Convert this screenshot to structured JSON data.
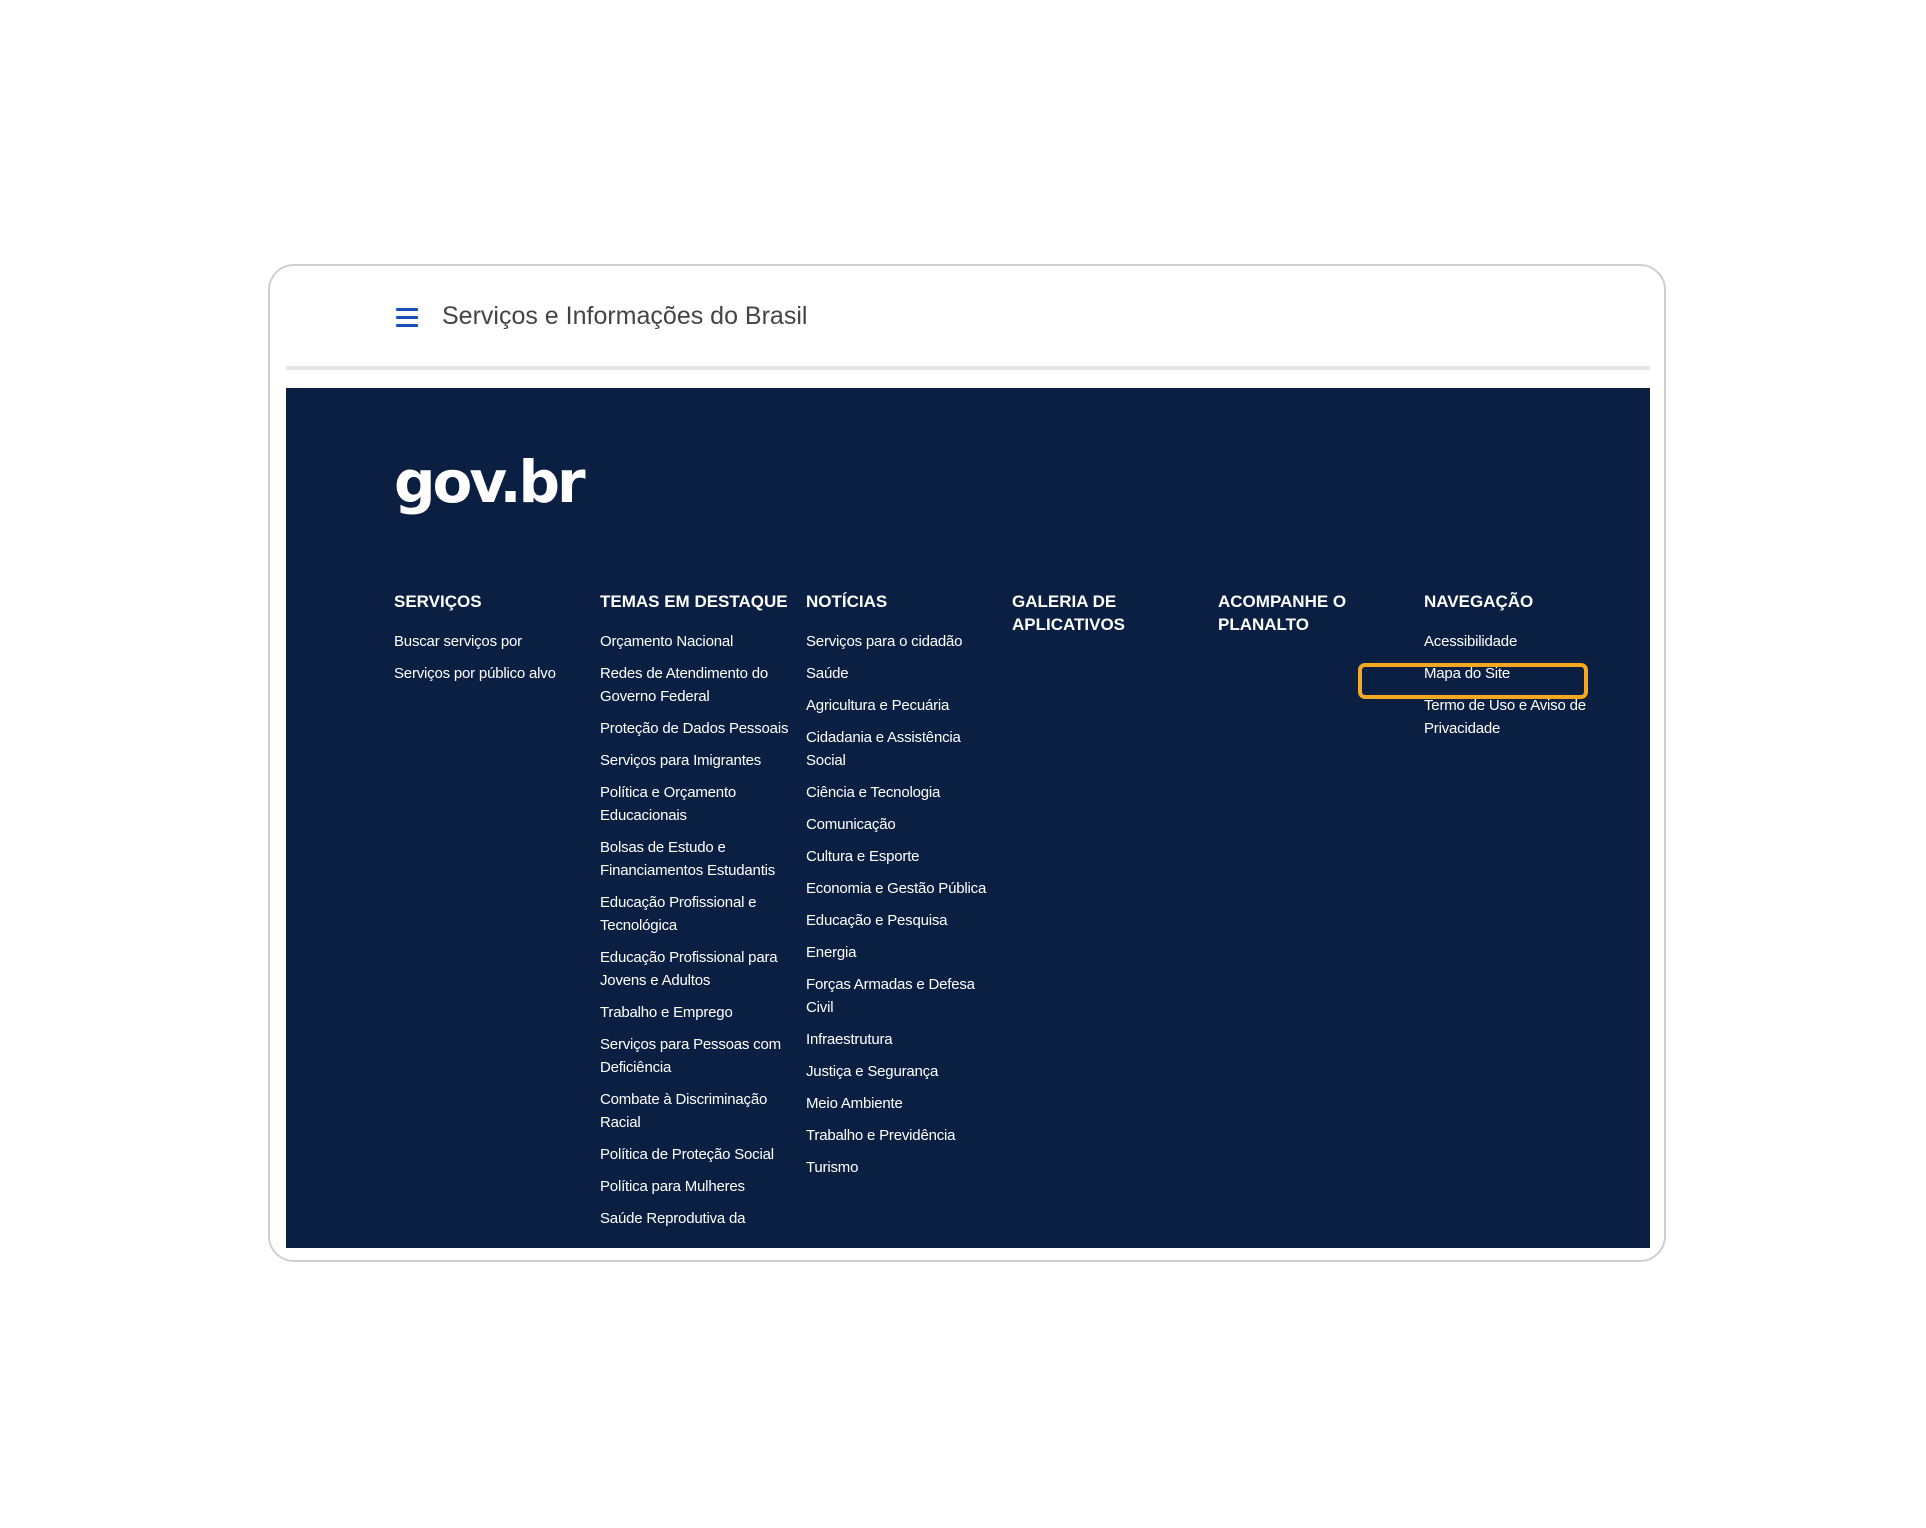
{
  "header": {
    "menu_icon": "hamburger-menu-icon",
    "title": "Serviços e Informações do Brasil",
    "accent_color": "#1351b4"
  },
  "footer": {
    "background_color": "#0b1f42",
    "logo_text": "gov.br",
    "columns": [
      {
        "heading": "SERVIÇOS",
        "links": [
          "Buscar serviços por",
          "Serviços por público alvo"
        ]
      },
      {
        "heading": "TEMAS EM DESTAQUE",
        "links": [
          "Orçamento Nacional",
          "Redes de Atendimento do Governo Federal",
          "Proteção de Dados Pessoais",
          "Serviços para Imigrantes",
          "Política e Orçamento Educacionais",
          "Bolsas de Estudo e Financiamentos Estudantis",
          "Educação Profissional e Tecnológica",
          "Educação Profissional para Jovens e Adultos",
          "Trabalho e Emprego",
          "Serviços para Pessoas com Deficiência",
          "Combate à Discriminação Racial",
          "Política de Proteção Social",
          "Política para Mulheres",
          "Saúde Reprodutiva da"
        ]
      },
      {
        "heading": "NOTÍCIAS",
        "links": [
          "Serviços para o cidadão",
          "Saúde",
          "Agricultura e Pecuária",
          "Cidadania e Assistência Social",
          "Ciência e Tecnologia",
          "Comunicação",
          "Cultura e Esporte",
          "Economia e Gestão Pública",
          "Educação e Pesquisa",
          "Energia",
          "Forças Armadas e Defesa Civil",
          "Infraestrutura",
          "Justiça e Segurança",
          "Meio Ambiente",
          "Trabalho e Previdência",
          "Turismo"
        ]
      },
      {
        "heading": "GALERIA DE APLICATIVOS",
        "links": []
      },
      {
        "heading": "ACOMPANHE O PLANALTO",
        "links": []
      },
      {
        "heading": "NAVEGAÇÃO",
        "links": [
          "Acessibilidade",
          "Mapa do Site",
          "Termo de Uso e Aviso de Privacidade"
        ]
      }
    ],
    "highlight_color": "#f6a821"
  }
}
